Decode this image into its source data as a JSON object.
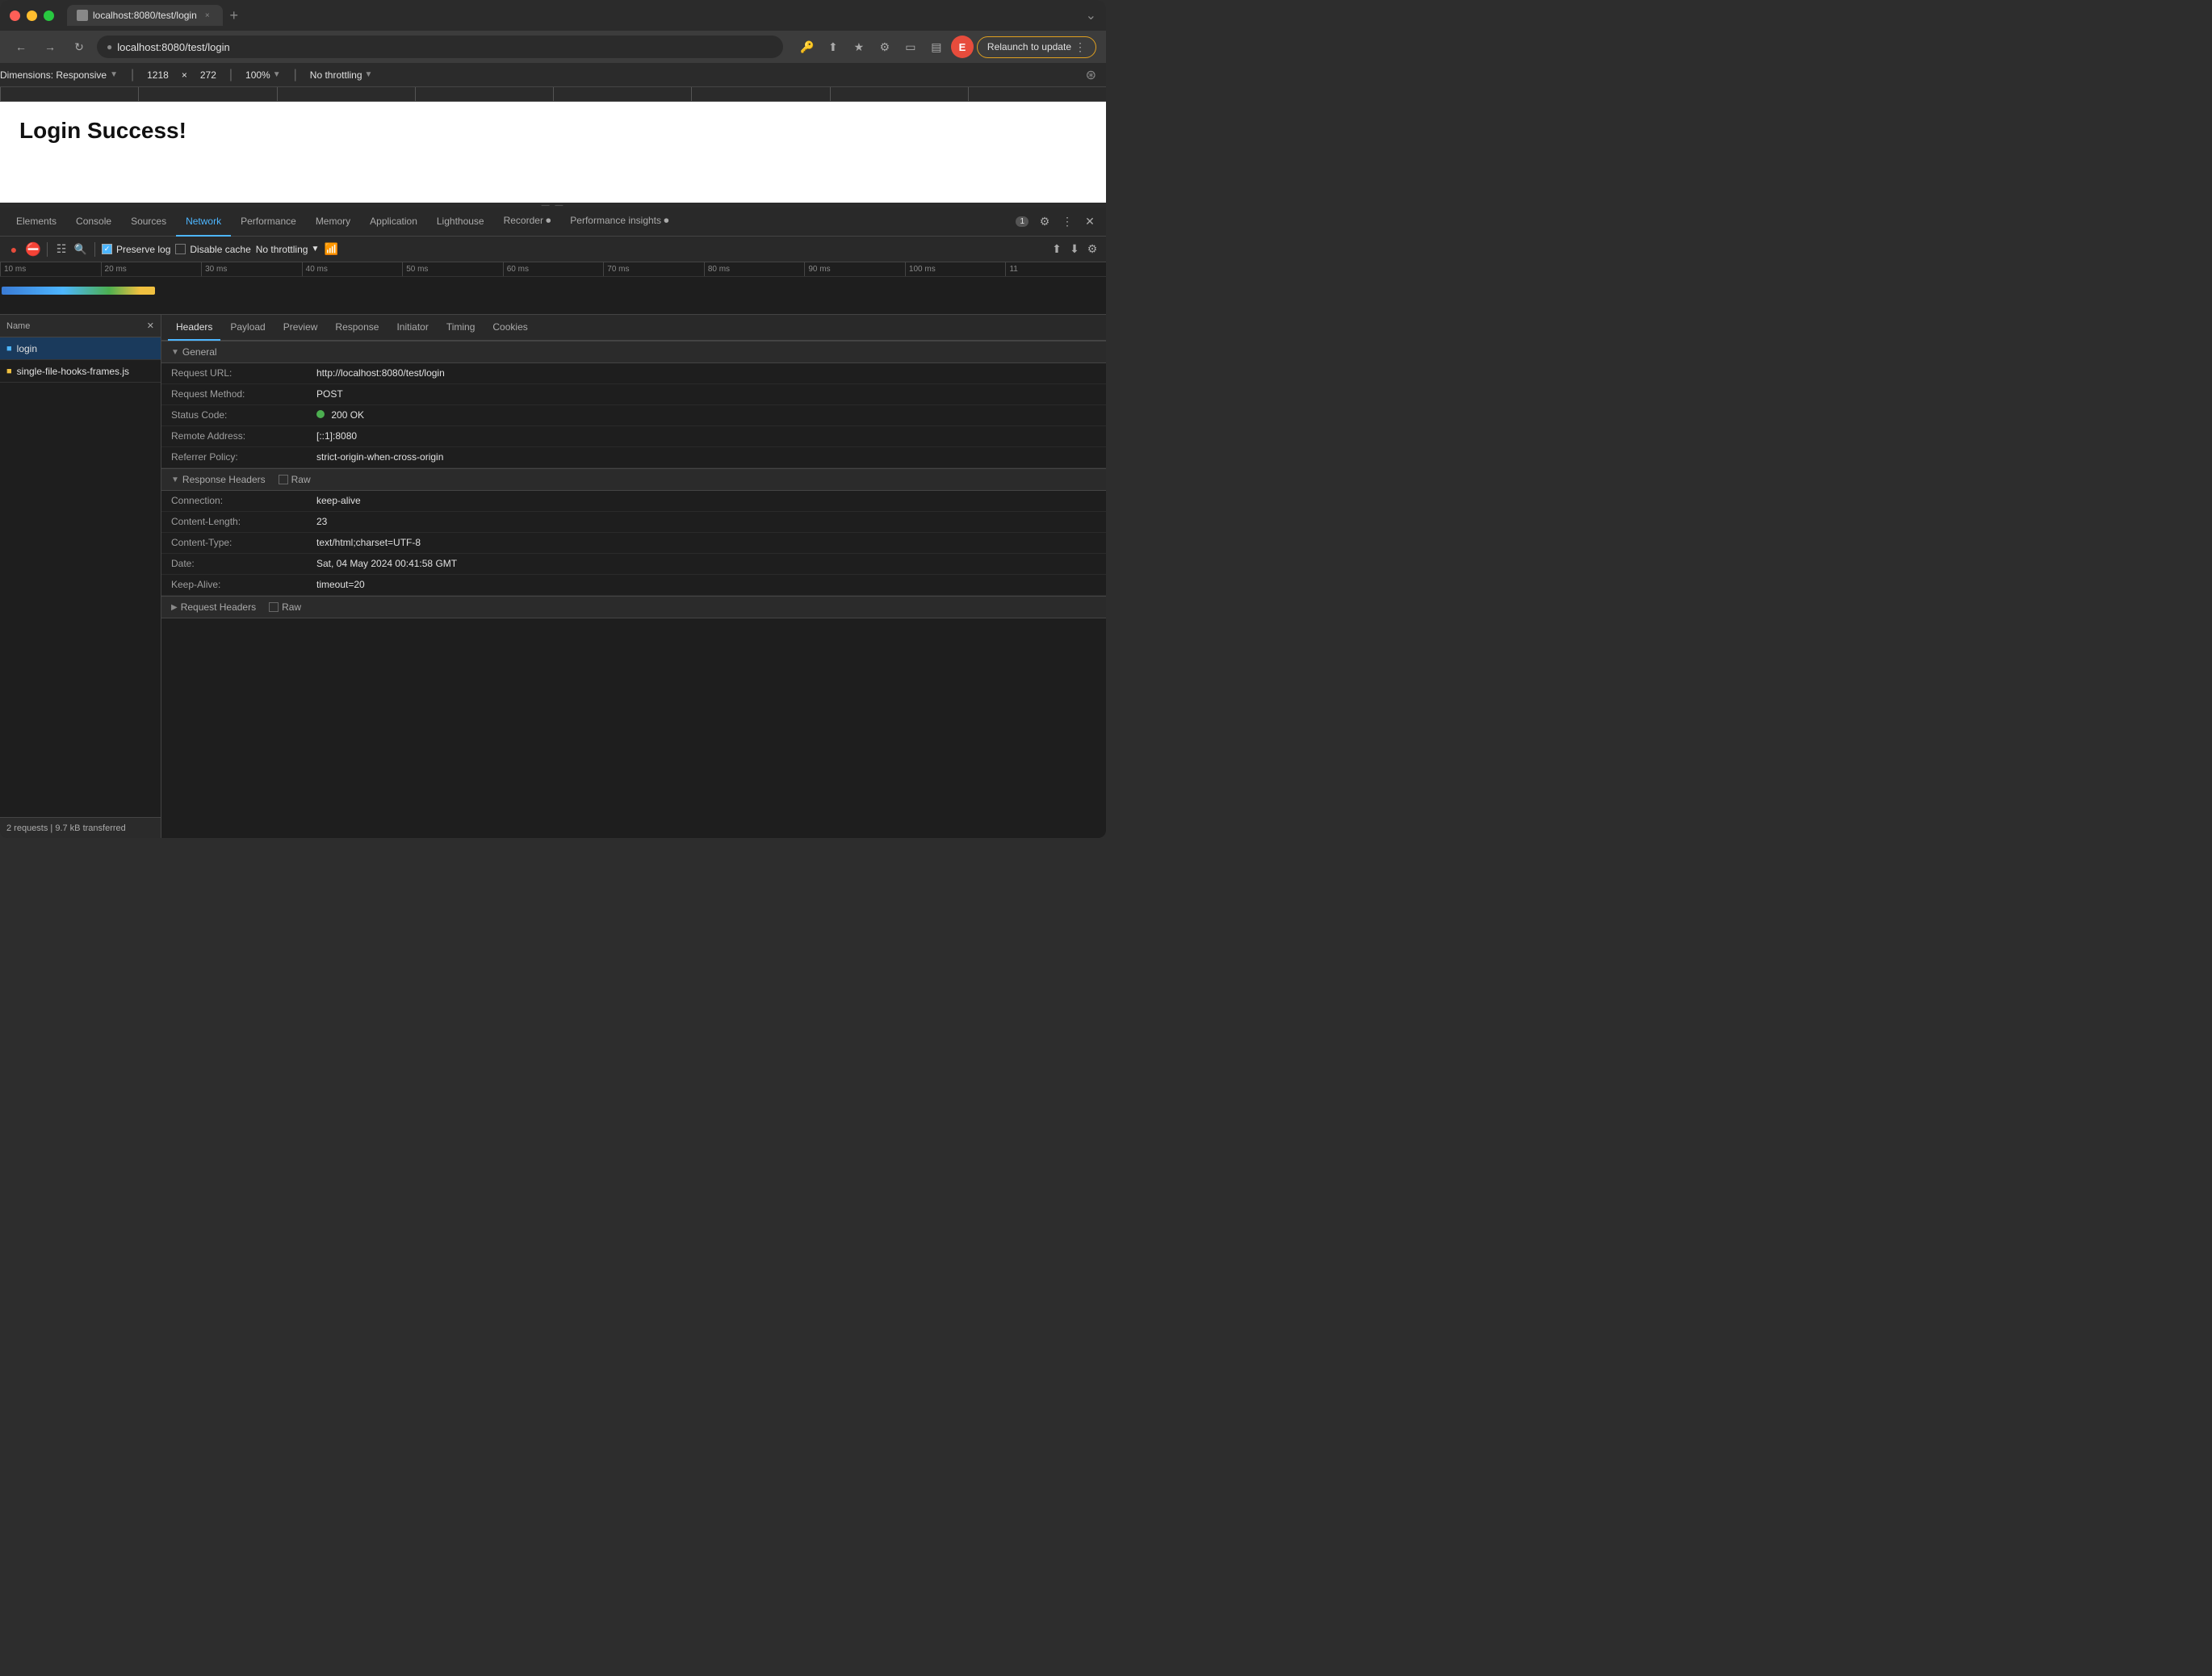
{
  "browser": {
    "tab_title": "localhost:8080/test/login",
    "tab_close": "×",
    "tab_new": "+",
    "tab_end": "⌄",
    "url": "localhost:8080/test/login",
    "relaunch_label": "Relaunch to update",
    "profile_initial": "E"
  },
  "devtools_dim_bar": {
    "dimensions_label": "Dimensions: Responsive",
    "width": "1218",
    "x_label": "×",
    "height": "272",
    "zoom_label": "100%",
    "throttle_label": "No throttling"
  },
  "page": {
    "title": "Login Success!"
  },
  "devtools": {
    "tabs": [
      {
        "label": "Elements",
        "active": false
      },
      {
        "label": "Console",
        "active": false
      },
      {
        "label": "Sources",
        "active": false
      },
      {
        "label": "Network",
        "active": true
      },
      {
        "label": "Performance",
        "active": false
      },
      {
        "label": "Memory",
        "active": false
      },
      {
        "label": "Application",
        "active": false
      },
      {
        "label": "Lighthouse",
        "active": false
      },
      {
        "label": "Recorder ⏺",
        "active": false
      },
      {
        "label": "Performance insights ⏺",
        "active": false
      }
    ],
    "badge": "1",
    "toolbar": {
      "preserve_log": "Preserve log",
      "disable_cache": "Disable cache",
      "throttle": "No throttling"
    },
    "timeline": {
      "ticks": [
        "10 ms",
        "20 ms",
        "30 ms",
        "40 ms",
        "50 ms",
        "60 ms",
        "70 ms",
        "80 ms",
        "90 ms",
        "100 ms",
        "11"
      ]
    },
    "request_list": {
      "header": "Name",
      "items": [
        {
          "icon": "doc",
          "name": "login"
        },
        {
          "icon": "js",
          "name": "single-file-hooks-frames.js"
        }
      ],
      "footer": "2 requests  |  9.7 kB transferred"
    },
    "details": {
      "tabs": [
        "Headers",
        "Payload",
        "Preview",
        "Response",
        "Initiator",
        "Timing",
        "Cookies"
      ],
      "active_tab": "Headers",
      "general_section": "General",
      "general_rows": [
        {
          "key": "Request URL:",
          "value": "http://localhost:8080/test/login"
        },
        {
          "key": "Request Method:",
          "value": "POST"
        },
        {
          "key": "Status Code:",
          "value": "200 OK",
          "status": true
        },
        {
          "key": "Remote Address:",
          "value": "[::1]:8080"
        },
        {
          "key": "Referrer Policy:",
          "value": "strict-origin-when-cross-origin"
        }
      ],
      "response_headers_section": "Response Headers",
      "response_rows": [
        {
          "key": "Connection:",
          "value": "keep-alive"
        },
        {
          "key": "Content-Length:",
          "value": "23"
        },
        {
          "key": "Content-Type:",
          "value": "text/html;charset=UTF-8"
        },
        {
          "key": "Date:",
          "value": "Sat, 04 May 2024 00:41:58 GMT"
        },
        {
          "key": "Keep-Alive:",
          "value": "timeout=20"
        }
      ],
      "request_headers_section": "Request Headers"
    }
  }
}
